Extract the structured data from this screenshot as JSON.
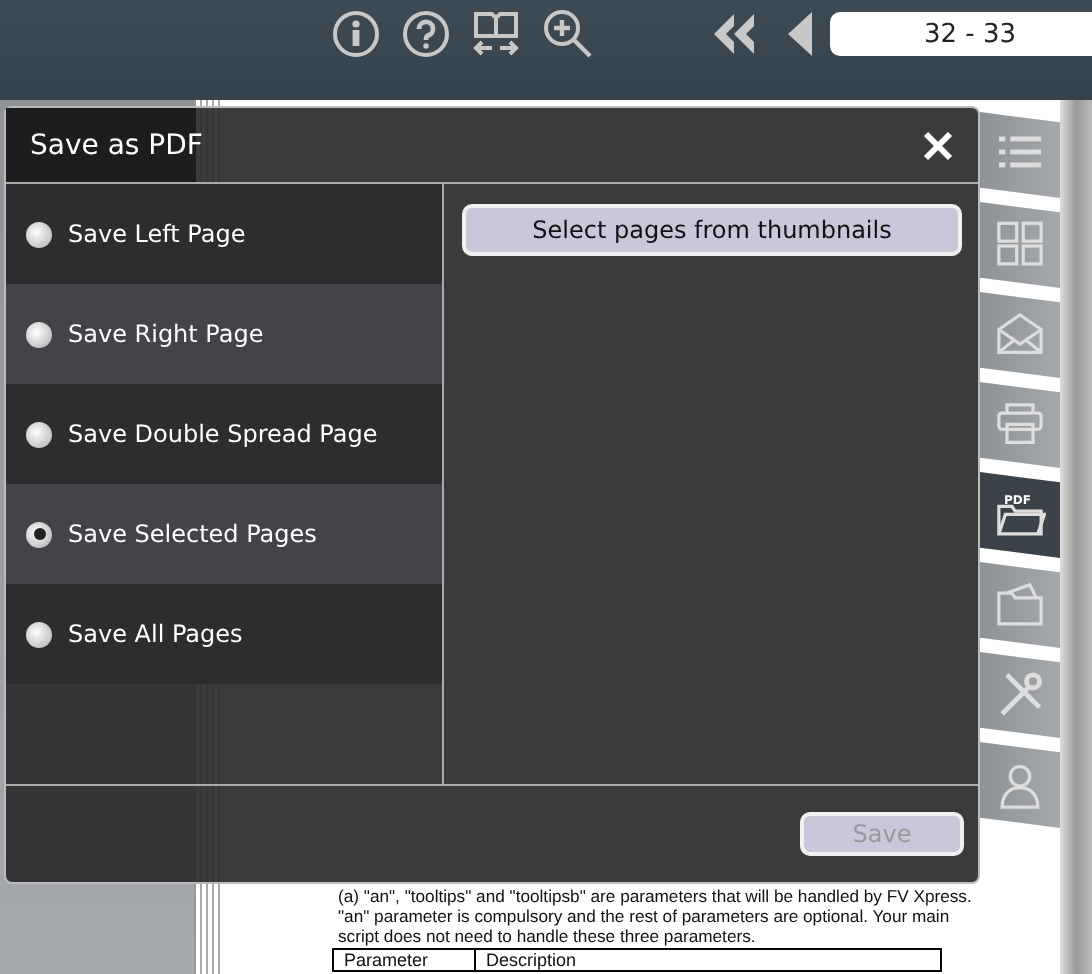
{
  "toolbar": {
    "tools": [
      {
        "kind": "info"
      },
      {
        "kind": "help"
      },
      {
        "kind": "spread"
      },
      {
        "kind": "zoom"
      },
      {
        "kind": "first"
      },
      {
        "kind": "prev"
      }
    ],
    "page_field": {
      "value": "32 - 33"
    }
  },
  "side_tabs": [
    {
      "kind": "contents",
      "selected": false
    },
    {
      "kind": "thumbnails",
      "selected": false
    },
    {
      "kind": "mail",
      "selected": false
    },
    {
      "kind": "print",
      "selected": false
    },
    {
      "kind": "pdf",
      "label": "PDF",
      "selected": true
    },
    {
      "kind": "folder",
      "selected": false
    },
    {
      "kind": "tools",
      "selected": false
    },
    {
      "kind": "person",
      "selected": false
    }
  ],
  "document": {
    "paragraph": "(a) \"an\", \"tooltips\" and \"tooltipsb\" are parameters that will be handled by FV Xpress. \"an\" parameter is compulsory and the rest of parameters are optional. Your main script does not need to handle these three parameters.",
    "table": {
      "columns": [
        "Parameter",
        "Description"
      ]
    }
  },
  "dialog": {
    "title": "Save as PDF",
    "options": [
      {
        "label": "Save Left Page",
        "selected": false
      },
      {
        "label": "Save Right Page",
        "selected": false
      },
      {
        "label": "Save Double Spread Page",
        "selected": false
      },
      {
        "label": "Save Selected Pages",
        "selected": true
      },
      {
        "label": "Save All Pages",
        "selected": false
      }
    ],
    "thumbnails_button": "Select pages from thumbnails",
    "save_button": {
      "label": "Save",
      "disabled": true
    }
  }
}
